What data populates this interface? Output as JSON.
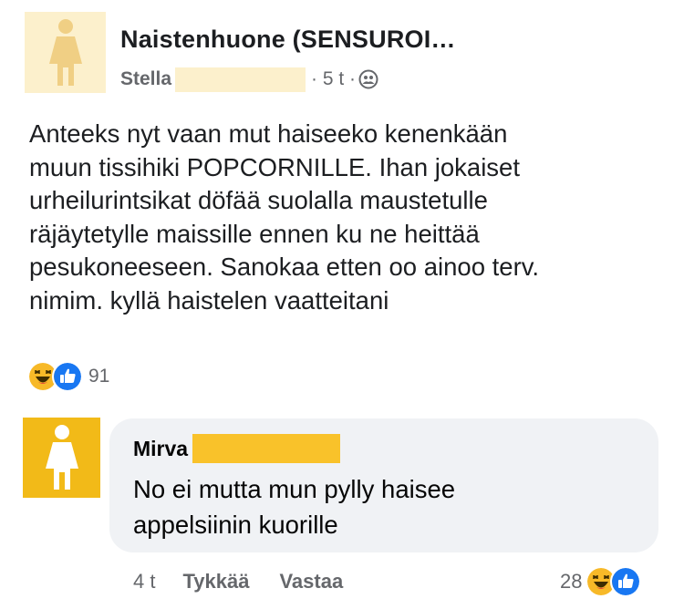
{
  "post": {
    "group_name": "Naistenhuone (SENSUROI…",
    "author_name": "Stella",
    "time": "· 5 t ·",
    "privacy_icon": "group-icon",
    "body_lines": [
      "Anteeks nyt vaan mut haiseeko kenenkään",
      "muun tissihiki POPCORNILLE. Ihan jokaiset",
      "urheilurintsikat döfää suolalla maustetulle",
      "räjäytetylle maissille ennen ku ne heittää",
      "pesukoneeseen. Sanokaa etten oo ainoo terv.",
      "nimim. kyllä haistelen vaatteitani"
    ],
    "reaction_icons": [
      "haha-icon",
      "like-icon"
    ],
    "reaction_count": "91"
  },
  "comment": {
    "author_name": "Mirva",
    "text_lines": [
      "No ei mutta mun pylly haisee",
      "appelsiinin kuorille"
    ],
    "time": "4 t",
    "like_label": "Tykkää",
    "reply_label": "Vastaa",
    "reaction_count": "28",
    "reaction_icons": [
      "haha-icon",
      "like-icon"
    ]
  },
  "colors": {
    "redaction_post": "#fcf0cc",
    "redaction_comment": "#f9c22a",
    "avatar_group": "#fcf0cc",
    "avatar_commenter": "#f2ba18",
    "like_blue": "#1877f2",
    "haha_yellow": "#f7b928"
  }
}
